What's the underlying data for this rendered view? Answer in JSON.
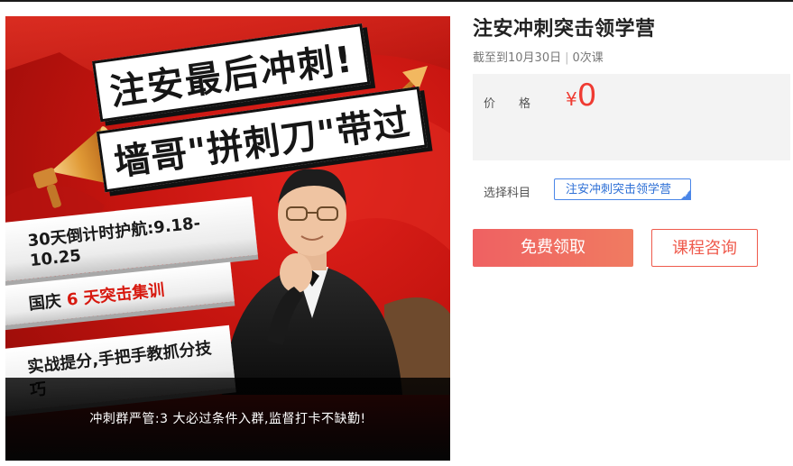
{
  "poster": {
    "headline_line1": "注安最后冲刺!",
    "headline_line2": "墙哥\"拼刺刀\"带过",
    "banner1": "30天倒计时护航:9.18-10.25",
    "banner2_prefix": "国庆",
    "banner2_highlight": "6 天突击集训",
    "banner3": "实战提分,手把手教抓分技巧",
    "footer": "冲刺群严管:3 大必过条件入群,监督打卡不缺勤!"
  },
  "course": {
    "title": "注安冲刺突击领学营",
    "deadline": "截至到10月30日",
    "separator": "|",
    "lessons": "0次课",
    "price_label": "价格",
    "currency": "¥",
    "price": "0",
    "subject_label": "选择科目",
    "subject_option": "注安冲刺突击领学营",
    "free_button": "免费领取",
    "consult_button": "课程咨询"
  },
  "colors": {
    "accent_red": "#ef3b32",
    "subject_blue": "#4a86e8"
  },
  "icons": [
    "megaphone-icon",
    "arrow-up-icon",
    "check-icon"
  ]
}
